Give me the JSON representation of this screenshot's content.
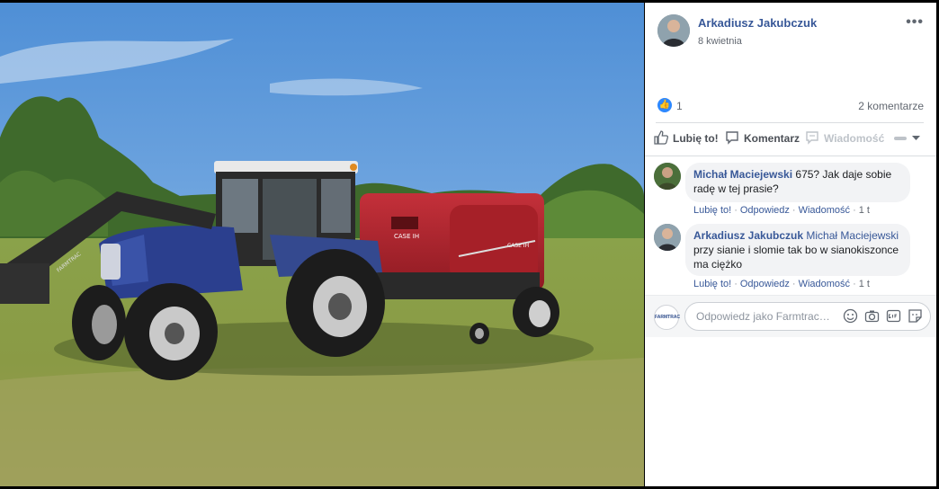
{
  "post": {
    "author": "Arkadiusz Jakubczuk",
    "date": "8 kwietnia",
    "more_icon": "more-horizontal-icon",
    "like_count": "1",
    "comments_count": "2 komentarze"
  },
  "actions": {
    "like": "Lubię to!",
    "comment": "Komentarz",
    "message": "Wiadomość"
  },
  "comments": [
    {
      "author": "Michał Maciejewski",
      "mention": "",
      "text": "675? Jak daje sobie radę w tej prasie?",
      "like": "Lubię to!",
      "reply": "Odpowiedz",
      "message": "Wiadomość",
      "time": "1 t"
    },
    {
      "author": "Arkadiusz Jakubczuk",
      "mention": "Michał Maciejewski",
      "text": "przy sianie i slomie tak bo w sianokiszonce ma ciężko",
      "like": "Lubię to!",
      "reply": "Odpowiedz",
      "message": "Wiadomość",
      "time": "1 t"
    }
  ],
  "reply": {
    "avatar_text": "FARMTRAC",
    "placeholder": "Odpowiedz jako Farmtrac ...",
    "icons": [
      "emoji-icon",
      "camera-icon",
      "gif-icon",
      "sticker-icon"
    ]
  },
  "photo": {
    "tractor_brand": "FARMTRAC",
    "baler_brand": "CASE IH"
  },
  "colors": {
    "link": "#385898",
    "like_blue": "#2d88ff"
  }
}
